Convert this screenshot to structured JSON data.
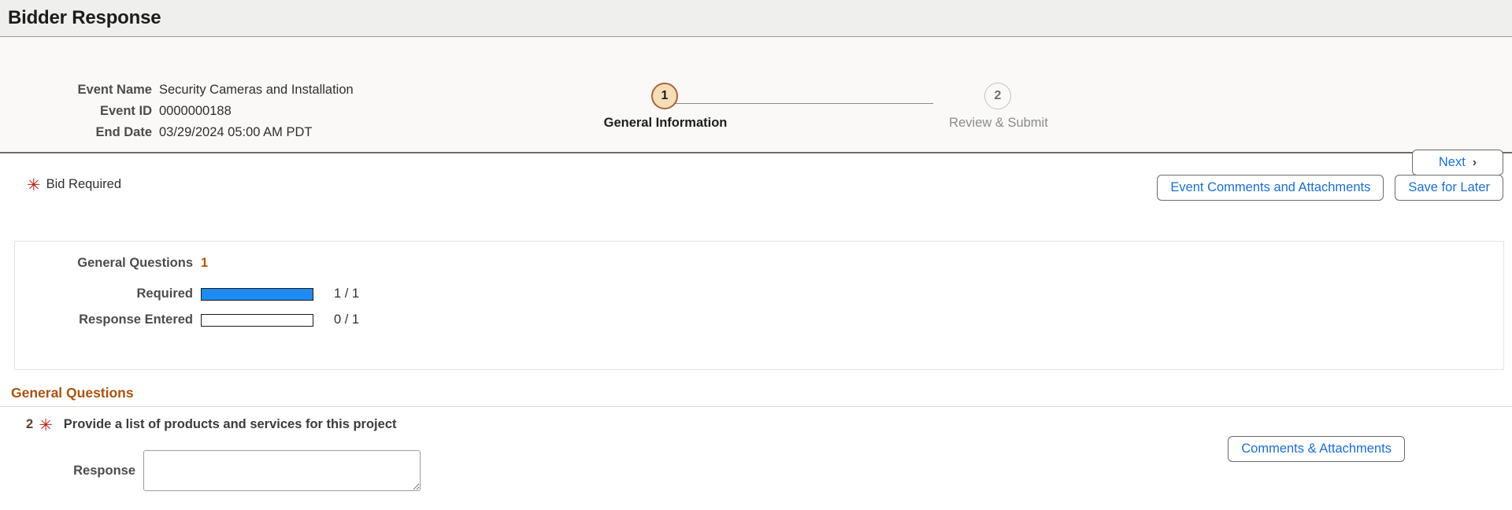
{
  "page": {
    "title": "Bidder Response"
  },
  "event_info": {
    "rows": [
      {
        "label": "Event Name",
        "value": "Security Cameras and Installation"
      },
      {
        "label": "Event ID",
        "value": "0000000188"
      },
      {
        "label": "End Date",
        "value": "03/29/2024 05:00 AM PDT"
      }
    ]
  },
  "stepper": {
    "steps": [
      {
        "number": "1",
        "label": "General Information",
        "state": "active"
      },
      {
        "number": "2",
        "label": "Review & Submit",
        "state": "inactive"
      }
    ]
  },
  "toolbar": {
    "next_label": "Next",
    "next_chevron": "›",
    "bid_required_label": "Bid Required",
    "bid_required_marker": "✳",
    "event_comments_label": "Event Comments and Attachments",
    "save_for_later_label": "Save for Later"
  },
  "summary": {
    "title_label": "General Questions",
    "title_count": "1",
    "rows": [
      {
        "label": "Required",
        "value": "1 / 1",
        "percent": 100
      },
      {
        "label": "Response Entered",
        "value": "0 / 1",
        "percent": 0
      }
    ]
  },
  "general_questions": {
    "heading": "General Questions",
    "question": {
      "number": "2",
      "marker": "✳",
      "text": "Provide a list of products and services for this project",
      "response_label": "Response",
      "response_value": "",
      "response_placeholder": "",
      "comments_label": "Comments & Attachments"
    }
  },
  "colors": {
    "accent_blue": "#1c6ecb",
    "progress_blue": "#1f8bf0",
    "heading_brown": "#a9530f",
    "required_red": "#b32317",
    "step_active_fill": "#f7ddb8",
    "step_active_border": "#a9663b"
  }
}
